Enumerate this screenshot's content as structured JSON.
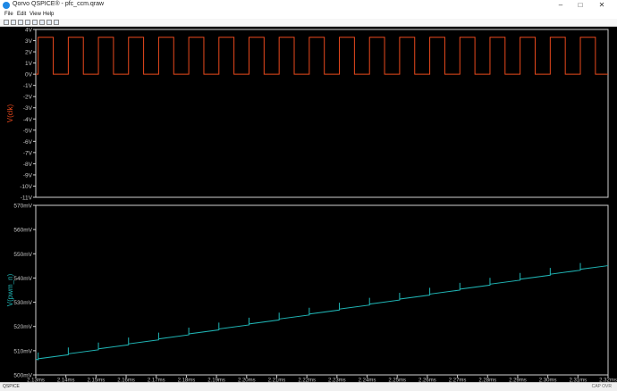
{
  "window": {
    "title": "Qorvo QSPICE® - pfc_ccm.qraw",
    "controls": {
      "minimize": "–",
      "maximize": "□",
      "close": "✕"
    }
  },
  "menu": {
    "items": [
      "File",
      "Edit",
      "View",
      "Help"
    ]
  },
  "toolbar": {
    "buttons": [
      "new-icon",
      "open-icon",
      "save-icon",
      "cut-icon",
      "copy-icon",
      "paste-icon",
      "print-icon",
      "zoom-icon"
    ]
  },
  "status": {
    "left": "QSPICE",
    "right": "CAP  OVR"
  },
  "colors": {
    "clk": "#e8491d",
    "pwm": "#20b5b5",
    "grid": "#ffffff",
    "text": "#c8c8c8"
  },
  "chart_data": [
    {
      "type": "line",
      "series": [
        {
          "name": "V(clk)",
          "color": "#e8491d",
          "low": 0,
          "high": 3.3,
          "period_ms": 0.01,
          "duty": 0.5,
          "first_rise_ms": 2.1308
        }
      ],
      "ylabel": "V(clk)",
      "ylim": [
        -11,
        4
      ],
      "yticks": [
        "4V",
        "3V",
        "2V",
        "1V",
        "0V",
        "-1V",
        "-2V",
        "-3V",
        "-4V",
        "-5V",
        "-6V",
        "-7V",
        "-8V",
        "-9V",
        "-10V",
        "-11V"
      ],
      "xlim": [
        2.13,
        2.32
      ]
    },
    {
      "type": "line",
      "series": [
        {
          "name": "V(pwm_n)",
          "color": "#20b5b5",
          "start_mv": 507.8,
          "end_mv": 546.8,
          "sawtooth_step_mv": 2.6,
          "period_ms": 0.01
        }
      ],
      "ylabel": "V(pwm_n)",
      "ylim": [
        500,
        570
      ],
      "yticks": [
        "570mV",
        "560mV",
        "550mV",
        "540mV",
        "530mV",
        "520mV",
        "510mV",
        "500mV"
      ],
      "xlim": [
        2.13,
        2.32
      ],
      "xticks": [
        "2.13ms",
        "2.14ms",
        "2.15ms",
        "2.16ms",
        "2.17ms",
        "2.18ms",
        "2.19ms",
        "2.20ms",
        "2.21ms",
        "2.22ms",
        "2.23ms",
        "2.24ms",
        "2.25ms",
        "2.26ms",
        "2.27ms",
        "2.28ms",
        "2.29ms",
        "2.30ms",
        "2.31ms",
        "2.32ms"
      ]
    }
  ]
}
